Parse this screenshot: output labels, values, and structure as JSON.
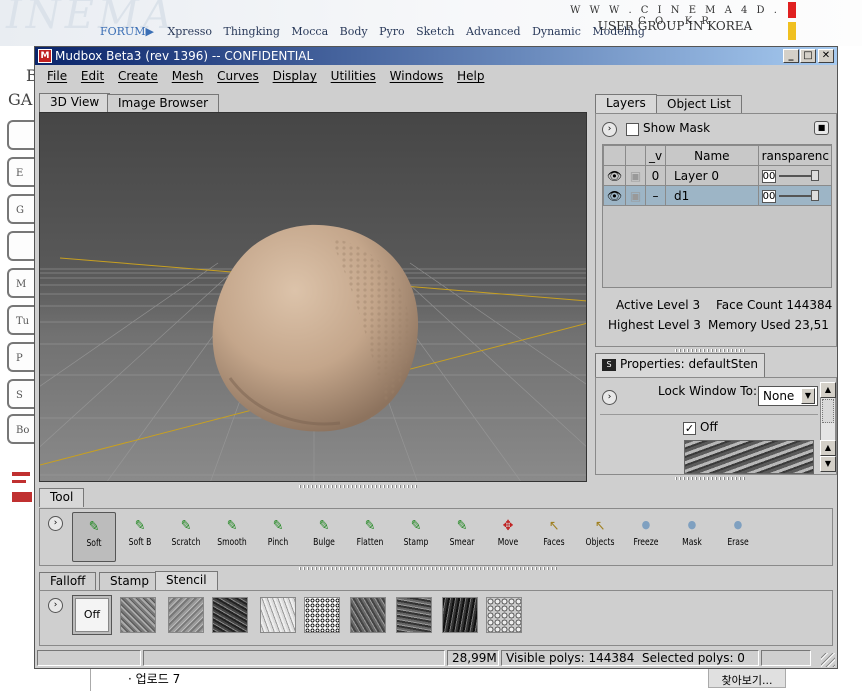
{
  "background": {
    "nav_prefix": "FORUM▶",
    "nav_items": [
      "Xpresso",
      "Thingking",
      "Mocca",
      "Body",
      "Pyro",
      "Sketch",
      "Advanced",
      "Dynamic",
      "Modeling"
    ],
    "site_domain": "W W W . C I N E M A 4 D . C O . K R",
    "site_tagline": "USER GROUP IN KOREA",
    "left_tab_letters": [
      "",
      "E",
      "G",
      "",
      "M",
      "Tu",
      "P",
      "S",
      "Bo"
    ],
    "upload_label": "· 업로드 7",
    "find_button": "찾아보기..."
  },
  "window": {
    "title": "Mudbox Beta3 (rev 1396) -- CONFIDENTIAL",
    "icon_label": "M",
    "controls": [
      "_",
      "□",
      "✕"
    ]
  },
  "menu": [
    "File",
    "Edit",
    "Create",
    "Mesh",
    "Curves",
    "Display",
    "Utilities",
    "Windows",
    "Help"
  ],
  "view_tabs": [
    {
      "label": "3D View",
      "active": true
    },
    {
      "label": "Image Browser",
      "active": false
    }
  ],
  "layers_panel": {
    "tabs": [
      {
        "label": "Layers",
        "active": true
      },
      {
        "label": "Object List",
        "active": false
      }
    ],
    "show_mask_label": "Show Mask",
    "columns": {
      "v": "_v",
      "name": "Name",
      "transparency": "ransparenc"
    },
    "rows": [
      {
        "level": "0",
        "name": "Layer 0",
        "value": "00",
        "selected": false
      },
      {
        "level": "–",
        "name": "d1",
        "value": "00",
        "selected": true
      }
    ],
    "stats": {
      "active_level_label": "Active Level",
      "active_level": "3",
      "face_count_label": "Face Count",
      "face_count": "144384",
      "highest_level_label": "Highest Level",
      "highest_level": "3",
      "memory_label": "Memory Used",
      "memory": "23,51"
    }
  },
  "properties_panel": {
    "tab_label": "Properties: defaultSten",
    "lock_label": "Lock Window To:",
    "lock_value": "None",
    "off_label": "Off"
  },
  "tool_section": {
    "tab": "Tool",
    "tools": [
      {
        "label": "Soft",
        "icon": "brush-icon",
        "glyph": "✎",
        "active": true
      },
      {
        "label": "Soft B",
        "icon": "brush-icon",
        "glyph": "✎"
      },
      {
        "label": "Scratch",
        "icon": "brush-icon",
        "glyph": "✎"
      },
      {
        "label": "Smooth",
        "icon": "brush-icon",
        "glyph": "✎"
      },
      {
        "label": "Pinch",
        "icon": "brush-icon",
        "glyph": "✎"
      },
      {
        "label": "Bulge",
        "icon": "brush-icon",
        "glyph": "✎"
      },
      {
        "label": "Flatten",
        "icon": "brush-icon",
        "glyph": "✎"
      },
      {
        "label": "Stamp",
        "icon": "brush-icon",
        "glyph": "✎"
      },
      {
        "label": "Smear",
        "icon": "brush-icon",
        "glyph": "✎"
      },
      {
        "label": "Move",
        "icon": "move-icon",
        "glyph": "✥"
      },
      {
        "label": "Faces",
        "icon": "cursor-icon",
        "glyph": "↖"
      },
      {
        "label": "Objects",
        "icon": "cursor-icon",
        "glyph": "↖"
      },
      {
        "label": "Freeze",
        "icon": "sphere-icon",
        "glyph": "●"
      },
      {
        "label": "Mask",
        "icon": "sphere-icon",
        "glyph": "●"
      },
      {
        "label": "Erase",
        "icon": "sphere-icon",
        "glyph": "●"
      }
    ]
  },
  "stencil_section": {
    "tabs": [
      {
        "label": "Falloff",
        "active": false
      },
      {
        "label": "Stamp",
        "active": false
      },
      {
        "label": "Stencil",
        "active": true
      }
    ],
    "off_label": "Off",
    "stamp_count": 9
  },
  "status_bar": {
    "memory": "28,99M",
    "visible_polys": "Visible polys: 144384",
    "selected_polys": "Selected polys: 0"
  },
  "colors": {
    "title_bar_start": "#0a246a",
    "title_bar_end": "#a6caf0",
    "panel_bg": "#cfcfcf",
    "selected_row": "#9db5c6",
    "mesh_color": "#c9ad94",
    "axis_line": "#c8a020"
  }
}
